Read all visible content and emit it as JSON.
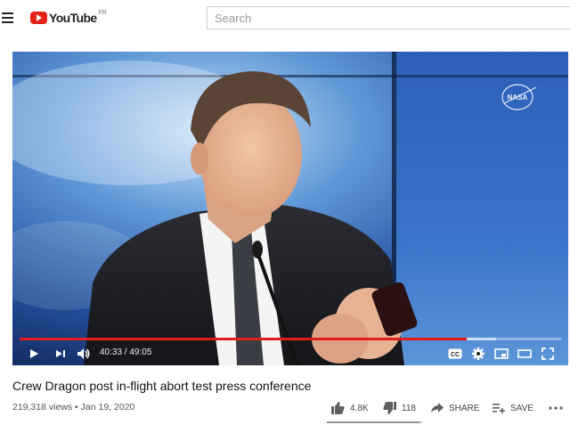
{
  "header": {
    "brand": "YouTube",
    "country": "FR",
    "search_placeholder": "Search"
  },
  "player": {
    "time_current": "40:33",
    "time_separator": " / ",
    "time_total": "49:05",
    "progress_played_fraction": 0.826,
    "progress_buffered_fraction": 0.88,
    "logo_text": "NASA",
    "colors": {
      "progress": "#e31d1d",
      "controls": "#ffffff"
    }
  },
  "video": {
    "title": "Crew Dragon post in-flight abort test press conference",
    "views": "219,318 views",
    "separator": " • ",
    "date": "Jan 19, 2020",
    "likes": "4.8K",
    "dislikes": "118",
    "share_label": "SHARE",
    "save_label": "SAVE",
    "like_ratio": 0.976
  },
  "icons": [
    "menu-icon",
    "youtube-logo-icon",
    "play-icon",
    "next-icon",
    "volume-icon",
    "captions-icon",
    "settings-icon",
    "miniplayer-icon",
    "theater-icon",
    "fullscreen-icon",
    "thumb-up-icon",
    "thumb-down-icon",
    "share-icon",
    "save-playlist-icon",
    "more-icon"
  ]
}
